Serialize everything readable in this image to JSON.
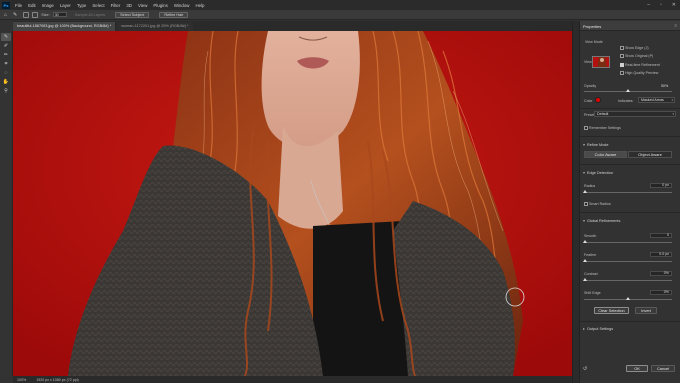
{
  "menubar": {
    "logo": "Ps",
    "items": [
      "File",
      "Edit",
      "Image",
      "Layer",
      "Type",
      "Select",
      "Filter",
      "3D",
      "View",
      "Plugins",
      "Window",
      "Help"
    ]
  },
  "optbar": {
    "size_label": "Size:",
    "size_value": "30",
    "sample_all_layers": "Sample All Layers",
    "select_subject": "Select Subject",
    "refine_hair": "Refine Hair"
  },
  "tabs": [
    {
      "label": "beautiful-1867093.jpg @ 100% (Background, RGB/8#) *",
      "active": true
    },
    {
      "label": "woman-1172201.jpg @ 25% (RGB/8#) *",
      "active": false
    }
  ],
  "status": {
    "zoom": "100%",
    "doc_size": "1920 px x 1080 px (72 ppi)"
  },
  "colors": {
    "overlay_red": "#c41414",
    "dot_red": "#e00000"
  },
  "panel": {
    "title": "Properties",
    "view_mode": {
      "heading": "View Mode",
      "view_label": "View:",
      "show_edge": "Show Edge (J)",
      "show_original": "Show Original (P)",
      "realtime_refinement": "Real-time Refinement",
      "high_quality_preview": "High Quality Preview",
      "show_edge_checked": false,
      "show_original_checked": false,
      "realtime_checked": true,
      "high_quality_checked": false
    },
    "opacity_label": "Opacity",
    "opacity_value": "50%",
    "opacity_level": 0.5,
    "color_label": "Color",
    "indicates_label": "Indicates:",
    "indicates_value": "Masked Areas",
    "preset_label": "Preset:",
    "preset_value": "Default",
    "remember_settings": "Remember Settings",
    "refine_mode_heading": "Refine Mode",
    "color_aware": "Color Aware",
    "object_aware": "Object Aware",
    "edge_detection_heading": "Edge Detection",
    "radius_label": "Radius",
    "radius_value": "0 px",
    "smart_radius": "Smart Radius",
    "global_refinements_heading": "Global Refinements",
    "smooth_label": "Smooth",
    "smooth_value": "0",
    "feather_label": "Feather",
    "feather_value": "0.0 px",
    "contrast_label": "Contrast",
    "contrast_value": "0%",
    "shift_edge_label": "Shift Edge",
    "shift_edge_value": "0%",
    "clear_selection": "Clear Selection",
    "invert": "Invert",
    "output_settings_heading": "Output Settings",
    "ok": "OK",
    "cancel": "Cancel"
  }
}
